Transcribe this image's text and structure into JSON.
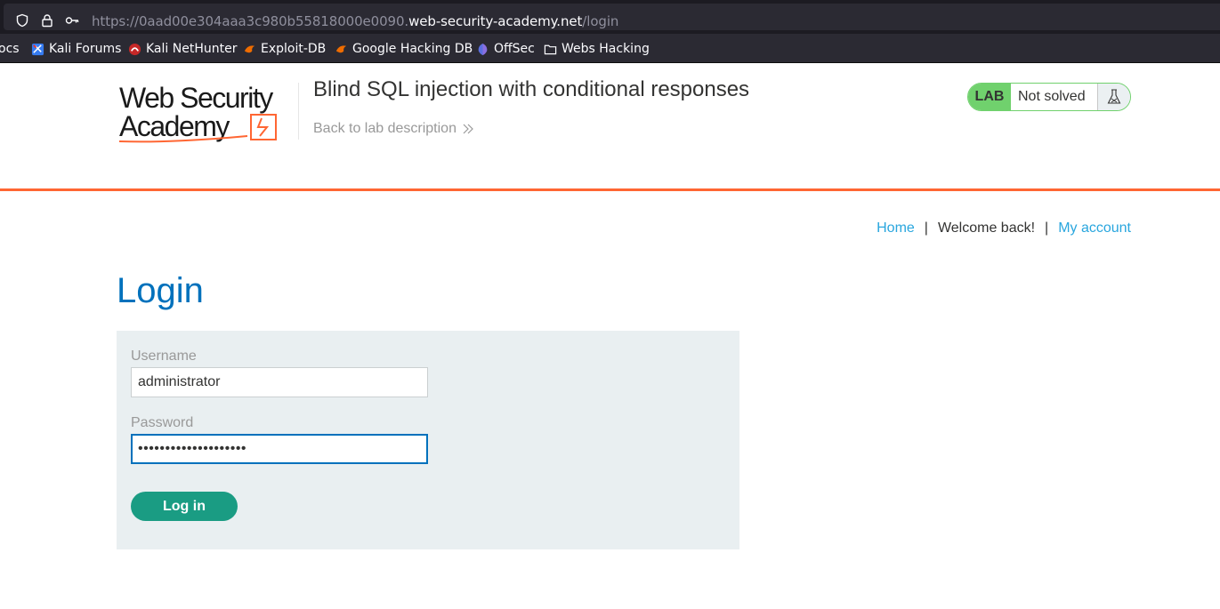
{
  "browser": {
    "url_prefix": "https://0aad00e304aaa3c980b55818000e0090.",
    "url_host": "web-security-academy.net",
    "url_path": "/login",
    "icons": [
      "shield-icon",
      "lock-icon",
      "key-icon"
    ]
  },
  "bookmarks": [
    {
      "label": "ocs",
      "icon": "none"
    },
    {
      "label": "Kali Forums",
      "icon": "kali-forums-icon"
    },
    {
      "label": "Kali NetHunter",
      "icon": "kali-nethunter-icon"
    },
    {
      "label": "Exploit-DB",
      "icon": "exploit-db-icon"
    },
    {
      "label": "Google Hacking DB",
      "icon": "ghdb-icon"
    },
    {
      "label": "OffSec",
      "icon": "offsec-icon"
    },
    {
      "label": "Webs Hacking",
      "icon": "folder-icon"
    }
  ],
  "header": {
    "logo_line1": "Web Security",
    "logo_line2": "Academy",
    "lab_title": "Blind SQL injection with conditional responses",
    "back_link": "Back to lab description",
    "status_badge": "LAB",
    "status_text": "Not solved",
    "colors": {
      "accent": "#ff6633",
      "badge": "#70d16d"
    }
  },
  "nav": {
    "home": "Home",
    "separator": "|",
    "welcome": "Welcome back!",
    "account": "My account"
  },
  "login": {
    "heading": "Login",
    "username_label": "Username",
    "username_value": "administrator",
    "password_label": "Password",
    "password_masked": "••••••••••••••••••••",
    "submit_label": "Log in",
    "colors": {
      "heading": "#0071bc",
      "button": "#1a9c83",
      "panel": "#e9eff1"
    }
  }
}
